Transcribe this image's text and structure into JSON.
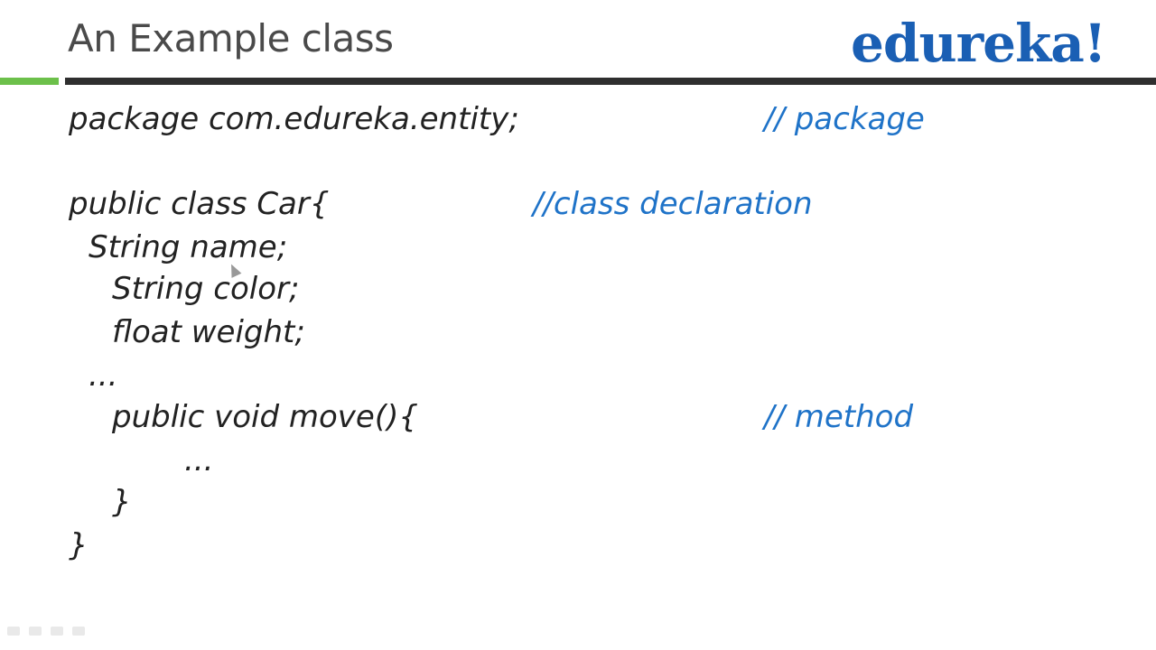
{
  "slide": {
    "title": "An Example class",
    "logo_text": "edureka!"
  },
  "code": {
    "line1": "package com.edureka.entity;",
    "line2": "public class Car{",
    "line3": "String name;",
    "line4": "String color;",
    "line5": "float weight;",
    "line6": "...",
    "line7": "public void move(){",
    "line8": "...",
    "line9": "}",
    "line10": "}"
  },
  "comments": {
    "package": "// package",
    "class_declaration": "//class declaration",
    "method": "// method"
  },
  "colors": {
    "comment": "#1f73c8",
    "logo": "#1a5fb4",
    "accent_green": "#6cc04a",
    "rule_dark": "#2f2f2f"
  },
  "icons": {
    "cursor": "mouse-pointer-icon",
    "presentation_controls": [
      "prev-icon",
      "pen-icon",
      "menu-icon",
      "next-icon"
    ]
  }
}
